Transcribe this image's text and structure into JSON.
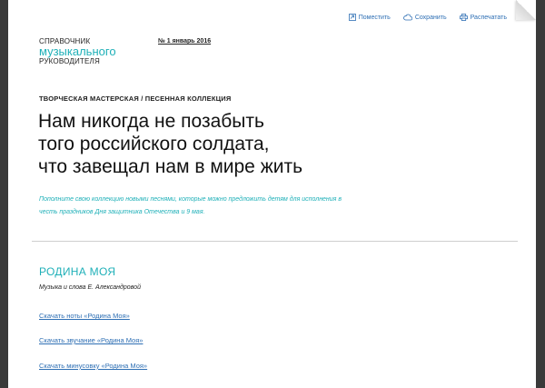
{
  "toolbar": {
    "post_label": "Поместить",
    "save_label": "Сохранить",
    "print_label": "Распечатать"
  },
  "logo": {
    "line1": "СПРАВОЧНИК",
    "line2": "музыкального",
    "line3": "РУКОВОДИТЕЛЯ"
  },
  "issue": "№ 1 январь 2016",
  "article": {
    "category": "ТВОРЧЕСКАЯ МАСТЕРСКАЯ / ПЕСЕННАЯ КОЛЛЕКЦИЯ",
    "title_lines": [
      "Нам никогда не позабыть",
      "того российского солдата,",
      "что завещал нам в мире жить"
    ],
    "lead_line1": "Пополните свою коллекцию новыми песнями, которые можно предложить детям для исполнения в",
    "lead_line2": "честь праздников Дня защитника Отечества и 9 мая."
  },
  "song": {
    "title": "РОДИНА МОЯ",
    "credits": "Музыка и слова Е. Александровой",
    "links": [
      "Скачать ноты «Родина Моя»",
      "Скачать звучание «Родина Моя»",
      "Скачать минусовку «Родина Моя»"
    ]
  },
  "colors": {
    "accent": "#1fb0b8",
    "link": "#2e6fb4",
    "text": "#111111"
  }
}
